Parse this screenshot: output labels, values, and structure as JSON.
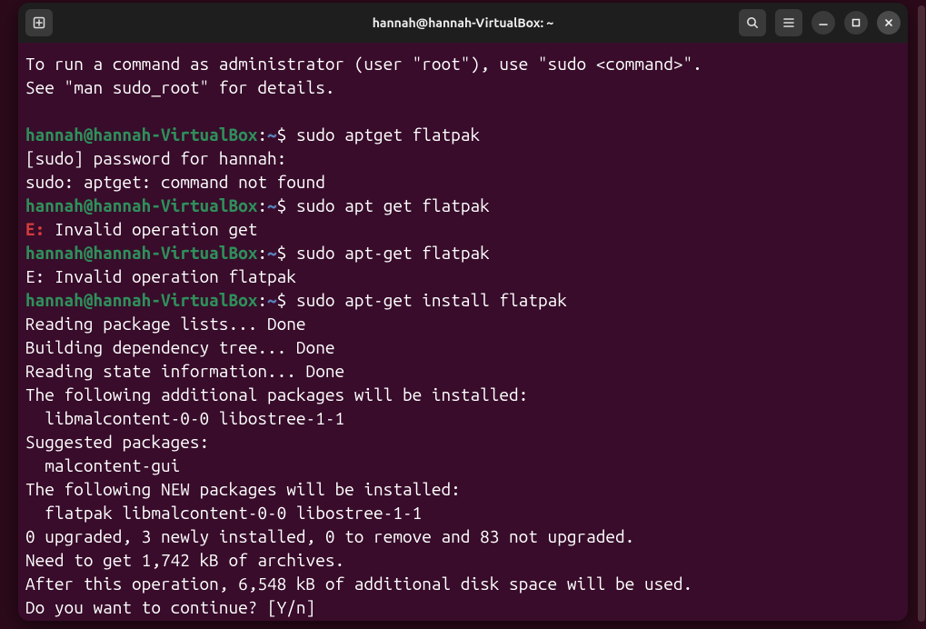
{
  "title": "hannah@hannah-VirtualBox: ~",
  "prompt": {
    "userHost": "hannah@hannah-VirtualBox",
    "sep": ":",
    "path": "~",
    "sym": "$ "
  },
  "intro": {
    "l1": "To run a command as administrator (user \"root\"), use \"sudo <command>\".",
    "l2": "See \"man sudo_root\" for details."
  },
  "cmd1": "sudo aptget flatpak",
  "out1a": "[sudo] password for hannah: ",
  "out1b": "sudo: aptget: command not found",
  "cmd2": "sudo apt get flatpak",
  "out2err": {
    "tag": "E:",
    "msg": " Invalid operation get"
  },
  "cmd3": "sudo apt-get flatpak",
  "out3": "E: Invalid operation flatpak",
  "cmd4": "sudo apt-get install flatpak",
  "out4": {
    "a": "Reading package lists... Done",
    "b": "Building dependency tree... Done",
    "c": "Reading state information... Done",
    "d": "The following additional packages will be installed:",
    "e": "  libmalcontent-0-0 libostree-1-1",
    "f": "Suggested packages:",
    "g": "  malcontent-gui",
    "h": "The following NEW packages will be installed:",
    "i": "  flatpak libmalcontent-0-0 libostree-1-1",
    "j": "0 upgraded, 3 newly installed, 0 to remove and 83 not upgraded.",
    "k": "Need to get 1,742 kB of archives.",
    "l": "After this operation, 6,548 kB of additional disk space will be used.",
    "m": "Do you want to continue? [Y/n] "
  }
}
